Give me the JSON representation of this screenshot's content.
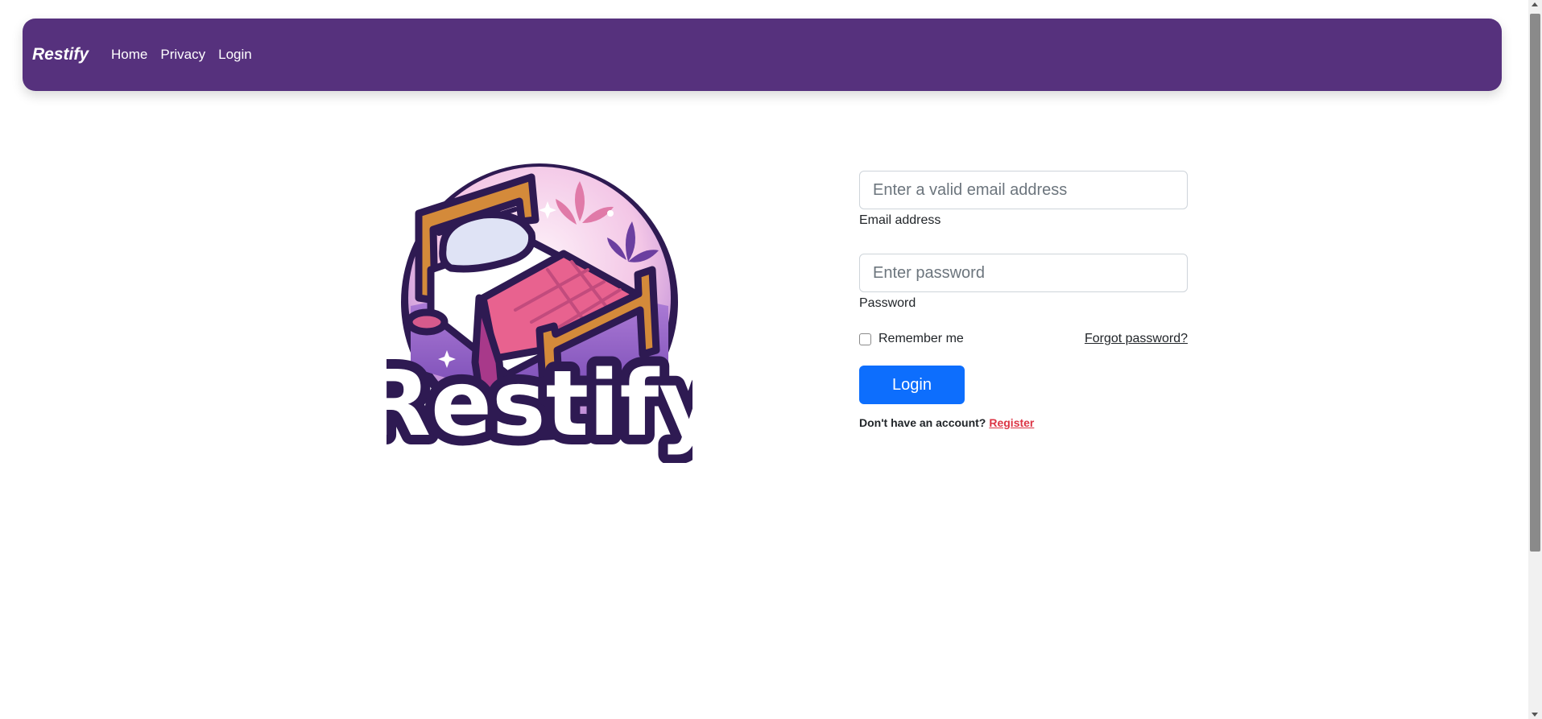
{
  "navbar": {
    "brand": "Restify",
    "links": [
      "Home",
      "Privacy",
      "Login"
    ]
  },
  "logo": {
    "text": "Restify"
  },
  "form": {
    "email_placeholder": "Enter a valid email address",
    "email_value": "",
    "email_label": "Email address",
    "password_placeholder": "Enter password",
    "password_value": "",
    "password_label": "Password",
    "remember_label": "Remember me",
    "remember_checked": false,
    "forgot_label": "Forgot password?",
    "login_label": "Login",
    "register_prompt": "Don't have an account?",
    "register_label": "Register"
  },
  "colors": {
    "navbar_bg": "#56317d",
    "primary_button": "#0d6efd",
    "register_link": "#dc3545",
    "logo_outline": "#2e1a52",
    "logo_circle": "#c89ae0"
  },
  "icons": [
    "bed-illustration-icon",
    "leaf-icon",
    "sparkle-icon"
  ]
}
